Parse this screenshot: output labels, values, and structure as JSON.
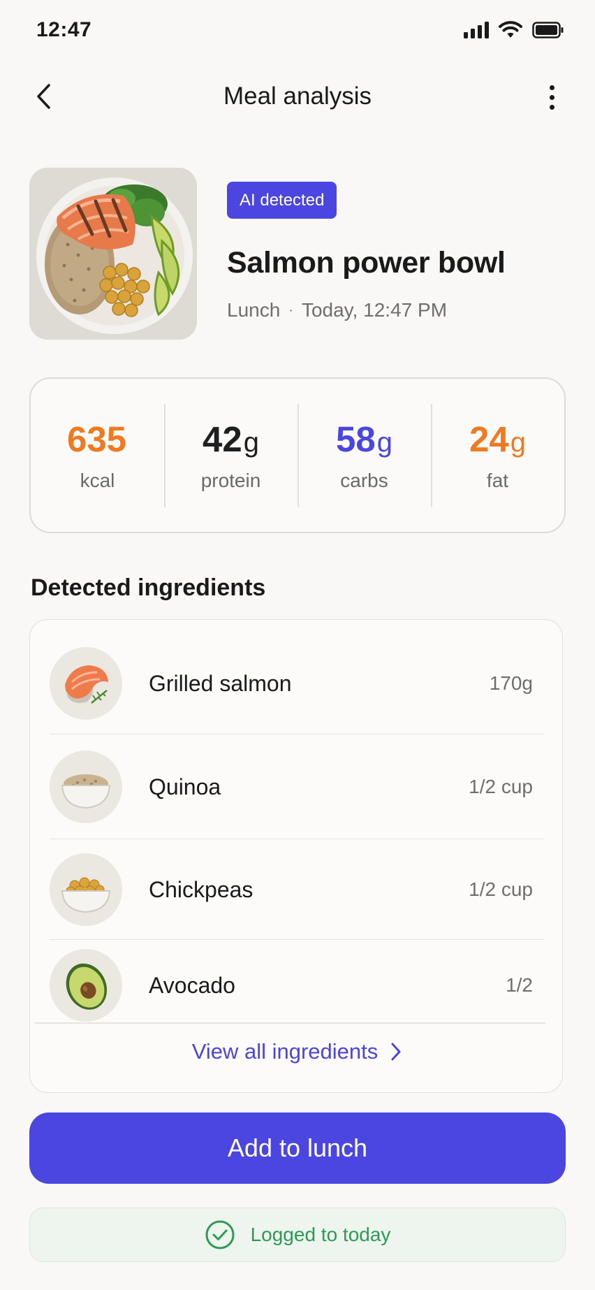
{
  "status_bar": {
    "time": "12:47"
  },
  "header": {
    "title": "Meal analysis"
  },
  "meal": {
    "badge": "AI detected",
    "name": "Salmon power bowl",
    "meal_type": "Lunch",
    "separator": "·",
    "timestamp": "Today, 12:47 PM"
  },
  "nutrition": [
    {
      "value": "635",
      "unit": "",
      "label": "kcal",
      "color": "#ee7b22"
    },
    {
      "value": "42",
      "unit": "g",
      "label": "protein",
      "color": "#1f1f1f"
    },
    {
      "value": "58",
      "unit": "g",
      "label": "carbs",
      "color": "#4b46df"
    },
    {
      "value": "24",
      "unit": "g",
      "label": "fat",
      "color": "#ee7b22"
    }
  ],
  "ingredients": {
    "title": "Detected ingredients",
    "items": [
      {
        "name": "Grilled salmon",
        "qty": "170g",
        "icon": "salmon-steak-icon"
      },
      {
        "name": "Quinoa",
        "qty": "1/2 cup",
        "icon": "quinoa-bowl-icon"
      },
      {
        "name": "Chickpeas",
        "qty": "1/2 cup",
        "icon": "chickpea-bowl-icon"
      },
      {
        "name": "Avocado",
        "qty": "1/2",
        "icon": "avocado-icon"
      }
    ],
    "view_all": "View all ingredients"
  },
  "actions": {
    "primary": "Add to lunch",
    "logged": "Logged to today"
  },
  "colors": {
    "accent": "#4b46df",
    "orange": "#ee7b22",
    "success": "#2e9a55"
  }
}
